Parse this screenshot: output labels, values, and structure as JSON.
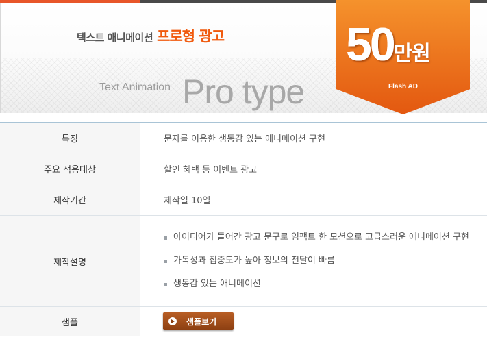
{
  "banner": {
    "tagline_small": "텍스트 애니메이션",
    "tagline_big": "프로형 광고",
    "eng_small": "Text Animation",
    "eng_big": "Pro type",
    "price_number": "50",
    "price_unit": "만원",
    "price_note": "Flash AD",
    "accent_color": "#f05a0e"
  },
  "table": {
    "rows": [
      {
        "label": "특징",
        "value": "문자를 이용한  생동감 있는 애니메이션 구현"
      },
      {
        "label": "주요 적용대상",
        "value": "할인 혜택 등 이벤트 광고"
      },
      {
        "label": "제작기간",
        "value": "제작일 10일"
      },
      {
        "label": "제작설명",
        "items": [
          "아이디어가 들어간 광고 문구로  임팩트 한  모션으로  고급스러운 애니메이션 구현",
          "가독성과  집중도가  높아  정보의 전달이 빠름",
          "생동감 있는 애니메이션"
        ]
      },
      {
        "label": "샘플",
        "button": "샘플보기"
      }
    ]
  }
}
